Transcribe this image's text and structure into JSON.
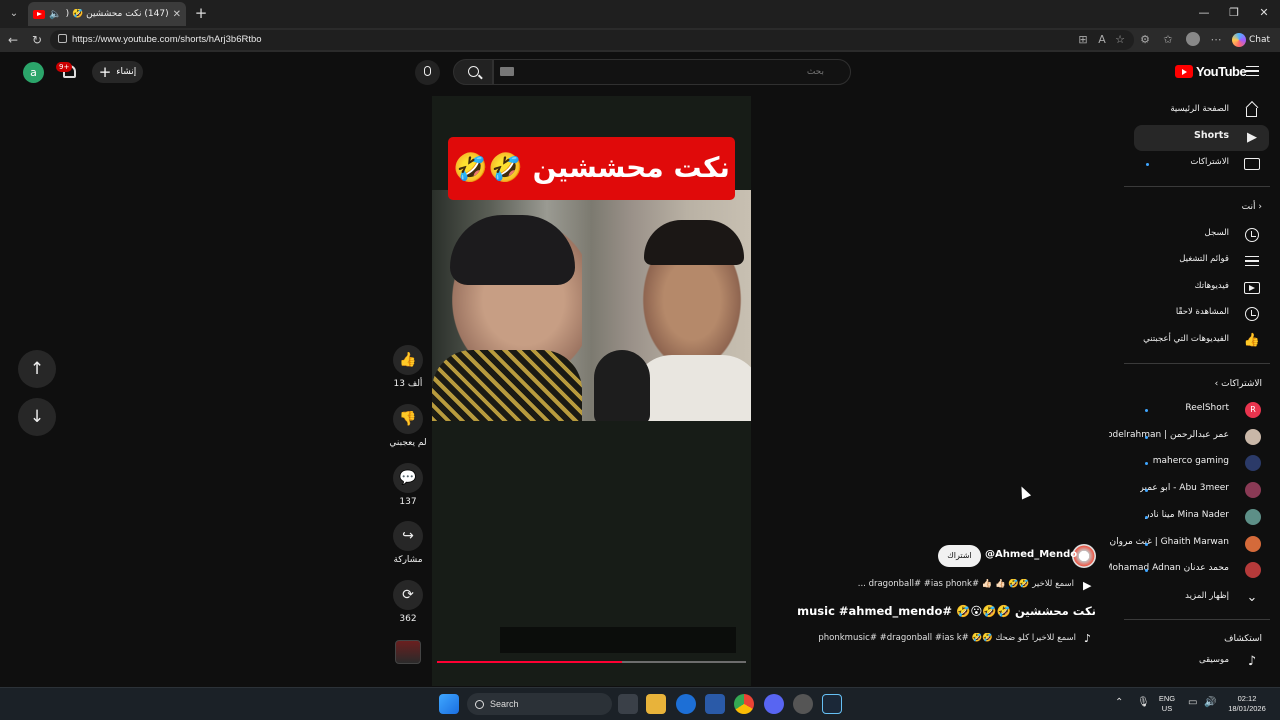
{
  "browser": {
    "tab_title": "(147) نكت محششين 🤣 ( 🤣😮🤣",
    "url": "https://www.youtube.com/shorts/hArj3b6Rtbo",
    "chat_label": "Chat"
  },
  "header": {
    "avatar_letter": "a",
    "notification_badge": "9+",
    "create_label": "إنشاء",
    "search_placeholder": "بحث",
    "logo_text": "YouTube"
  },
  "video": {
    "banner_text": "نكت محششين 🤣🤣",
    "progress_fraction": 0.6
  },
  "actions": {
    "like_count": "13 ألف",
    "dislike_label": "لم يعجبني",
    "comment_count": "137",
    "share_label": "مشاركة",
    "remix_count": "362"
  },
  "channel": {
    "name": "@Ahmed_Mendo",
    "subscribe_label": "اشتراك",
    "sound_line": "اسمع للاخير 🤣🤣 👍🏻 👍🏻 #dragonball# #ias phonk ...",
    "title": "نكت محششين 🤣🤣😮🤣 #music #ahmed_mendo ...",
    "music_line": "اسمع للاخيرا كلو ضحك 🤣🤣 #phonkmusic# #dragonball #ias k"
  },
  "sidebar": {
    "main": [
      {
        "label": "الصفحة الرئيسية",
        "icon": "home-icon"
      },
      {
        "label": "Shorts",
        "icon": "shorts-icon",
        "active": true
      },
      {
        "label": "الاشتراكات",
        "icon": "subscriptions-icon"
      }
    ],
    "you_heading": "أنت",
    "you": [
      {
        "label": "السجل",
        "icon": "history-icon"
      },
      {
        "label": "قوائم التشغيل",
        "icon": "playlists-icon"
      },
      {
        "label": "فيديوهاتك",
        "icon": "your-videos-icon"
      },
      {
        "label": "المشاهدة لاحقًا",
        "icon": "watch-later-icon"
      },
      {
        "label": "الفيديوهات التي أعجبتني",
        "icon": "liked-icon"
      }
    ],
    "subs_heading": "الاشتراكات",
    "subscriptions": [
      {
        "label": "ReelShort",
        "color": "#e8344e",
        "letter": "R"
      },
      {
        "label": "عمر عبدالرحمن | Omar Abdelrahman",
        "color": "#c9b7a8",
        "letter": ""
      },
      {
        "label": "maherco gaming",
        "color": "#2b3a68",
        "letter": ""
      },
      {
        "label": "Abu 3meer - ابو عمير",
        "color": "#8a3a55",
        "letter": ""
      },
      {
        "label": "Mina Nader مينا نادر",
        "color": "#5d8f87",
        "letter": ""
      },
      {
        "label": "Ghaith Marwan | غيث مروان",
        "color": "#d46a3a",
        "letter": ""
      },
      {
        "label": "محمد عدنان Mohamad Adnan",
        "color": "#b53a3a",
        "letter": ""
      }
    ],
    "show_more": "إظهار المزيد",
    "explore_heading": "استكشاف",
    "explore": [
      {
        "label": "موسيقى",
        "icon": "music-icon"
      }
    ]
  },
  "taskbar": {
    "search_label": "Search",
    "lang_line1": "ENG",
    "lang_line2": "US",
    "time": "02:12",
    "date": "18/01/2026"
  }
}
